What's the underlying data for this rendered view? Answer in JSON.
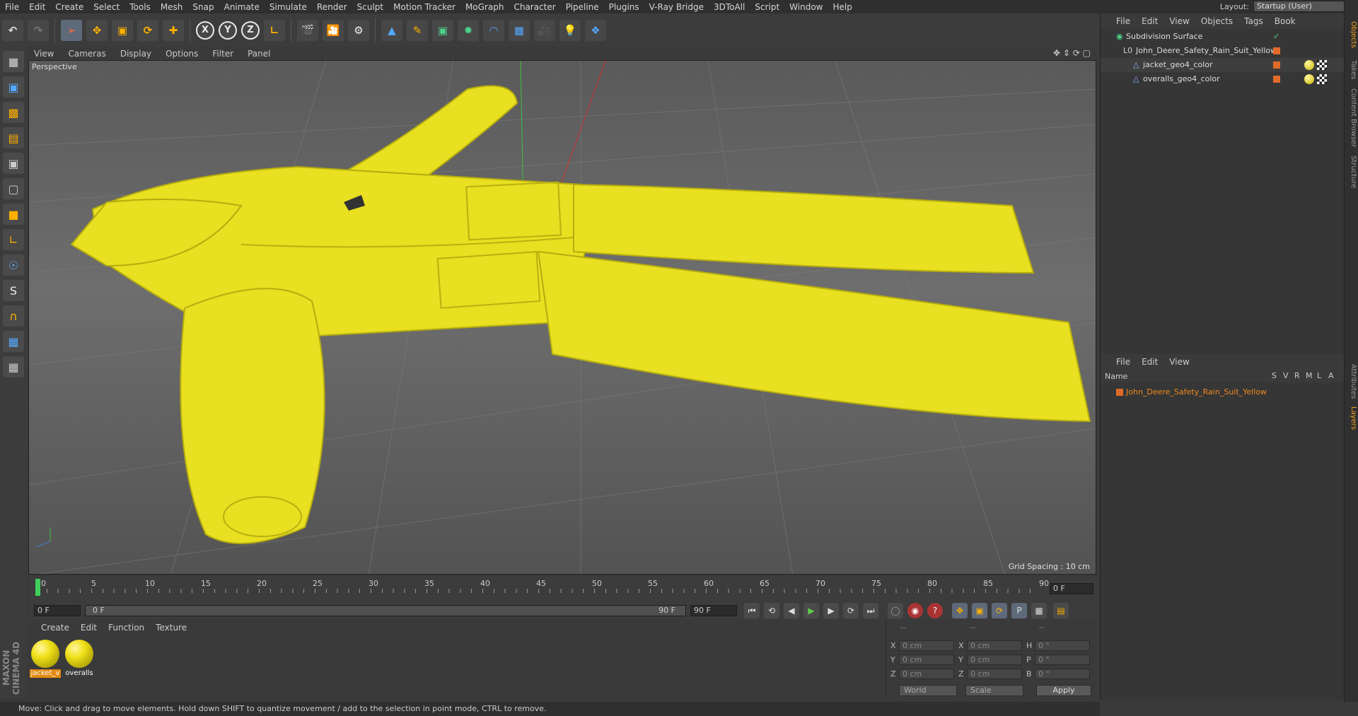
{
  "menubar": {
    "items": [
      "File",
      "Edit",
      "Create",
      "Select",
      "Tools",
      "Mesh",
      "Snap",
      "Animate",
      "Simulate",
      "Render",
      "Sculpt",
      "Motion Tracker",
      "MoGraph",
      "Character",
      "Pipeline",
      "Plugins",
      "V-Ray Bridge",
      "3DToAll",
      "Script",
      "Window",
      "Help"
    ],
    "layout_label": "Layout:",
    "layout_value": "Startup (User)"
  },
  "toolbar": {
    "buttons": [
      "undo-icon",
      "redo-icon",
      "live-selection-icon",
      "move-icon",
      "scale-icon",
      "rotate-icon",
      "recent-tool-icon",
      "x-axis-lock",
      "y-axis-lock",
      "z-axis-lock",
      "world-coordinates-icon",
      "render-view-icon",
      "render-picture-viewer-icon",
      "render-settings-icon",
      "cube-icon",
      "pen-spline-icon",
      "subdivision-icon",
      "cloner-icon",
      "deformer-icon",
      "floor-icon",
      "camera-icon",
      "light-icon",
      "python-icon"
    ],
    "axis_x": "X",
    "axis_y": "Y",
    "axis_z": "Z"
  },
  "viewport": {
    "menu": [
      "View",
      "Cameras",
      "Display",
      "Options",
      "Filter",
      "Panel"
    ],
    "camera_label": "Perspective",
    "grid_spacing": "Grid Spacing : 10 cm"
  },
  "timeline": {
    "ticks": [
      "0",
      "5",
      "10",
      "15",
      "20",
      "25",
      "30",
      "35",
      "40",
      "45",
      "50",
      "55",
      "60",
      "65",
      "70",
      "75",
      "80",
      "85",
      "90"
    ],
    "current_frame": "0 F"
  },
  "transport": {
    "start_frame": "0 F",
    "range_start": "0 F",
    "range_end": "90 F",
    "end_frame": "90 F"
  },
  "material_panel": {
    "menu": [
      "Create",
      "Edit",
      "Function",
      "Texture"
    ],
    "materials": [
      {
        "label": "jacket_v",
        "selected": true
      },
      {
        "label": "overalls",
        "selected": false
      }
    ]
  },
  "coordinates": {
    "col_headers": [
      "--",
      "--",
      "--"
    ],
    "rows": [
      {
        "a1": "X",
        "v1": "0 cm",
        "a2": "X",
        "v2": "0 cm",
        "a3": "H",
        "v3": "0 °"
      },
      {
        "a1": "Y",
        "v1": "0 cm",
        "a2": "Y",
        "v2": "0 cm",
        "a3": "P",
        "v3": "0 °"
      },
      {
        "a1": "Z",
        "v1": "0 cm",
        "a2": "Z",
        "v2": "0 cm",
        "a3": "B",
        "v3": "0 °"
      }
    ],
    "coord_mode": "World",
    "size_mode": "Scale",
    "apply_label": "Apply"
  },
  "object_manager": {
    "menu": [
      "File",
      "Edit",
      "View",
      "Objects",
      "Tags",
      "Book"
    ],
    "objects": [
      {
        "name": "Subdivision Surface",
        "indent": 0
      },
      {
        "name": "John_Deere_Safety_Rain_Suit_Yellow",
        "indent": 1
      },
      {
        "name": "jacket_geo4_color",
        "indent": 2
      },
      {
        "name": "overalls_geo4_color",
        "indent": 2
      }
    ]
  },
  "layer_manager": {
    "menu": [
      "File",
      "Edit",
      "View"
    ],
    "header_name": "Name",
    "columns": [
      "S",
      "V",
      "R",
      "M",
      "L",
      "A"
    ],
    "layers": [
      "John_Deere_Safety_Rain_Suit_Yellow"
    ]
  },
  "side_tabs": [
    "Objects",
    "Takes",
    "Content Browser",
    "Structure",
    "Attributes",
    "Layers"
  ],
  "status": "Move: Click and drag to move elements. Hold down SHIFT to quantize movement / add to the selection in point mode, CTRL to remove.",
  "branding": "MAXON CINEMA 4D",
  "colors": {
    "accent": "#f0a020",
    "suit": "#e8e020",
    "layer_orange": "#f08a1c"
  }
}
